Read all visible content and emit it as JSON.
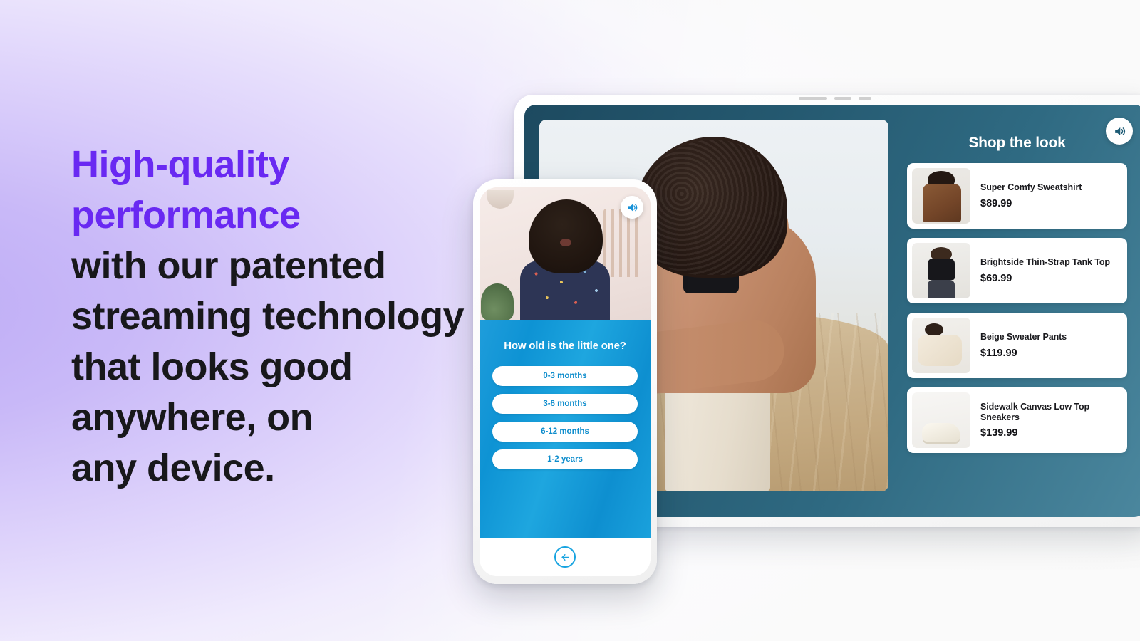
{
  "theme": {
    "accent_purple": "#6929f2",
    "text_dark": "#18181b",
    "page_bg": "#f4f4f5",
    "tablet_teal": "#24586f",
    "quiz_blue": "#0e93d4",
    "quiz_text_blue": "#0c8ccc"
  },
  "headline": {
    "lines": [
      {
        "text": "High-quality",
        "accent": true
      },
      {
        "text": "performance",
        "accent": true
      },
      {
        "text": "with our patented",
        "accent": false
      },
      {
        "text": "streaming technology",
        "accent": false
      },
      {
        "text": "that looks good",
        "accent": false
      },
      {
        "text": "anywhere, on",
        "accent": false
      },
      {
        "text": "any device.",
        "accent": false
      }
    ]
  },
  "tablet": {
    "sound_icon": "speaker-on-icon",
    "video_alt": "woman in tan hoodie in desert",
    "shop": {
      "title": "Shop the look",
      "products": [
        {
          "name": "Super Comfy Sweatshirt",
          "price": "$89.99",
          "thumb": "sweatshirt-thumb"
        },
        {
          "name": "Brightside Thin-Strap Tank Top",
          "price": "$69.99",
          "thumb": "tank-top-thumb"
        },
        {
          "name": "Beige Sweater Pants",
          "price": "$119.99",
          "thumb": "sweater-pants-thumb"
        },
        {
          "name": "Sidewalk Canvas Low Top Sneakers",
          "price": "$139.99",
          "thumb": "sneakers-thumb"
        }
      ]
    }
  },
  "phone": {
    "sound_icon": "speaker-on-icon",
    "video_alt": "woman presenter in patterned blouse",
    "quiz": {
      "question": "How old is the little one?",
      "options": [
        "0-3 months",
        "3-6 months",
        "6-12 months",
        "1-2 years"
      ]
    },
    "back_icon": "arrow-left-circle-icon"
  }
}
